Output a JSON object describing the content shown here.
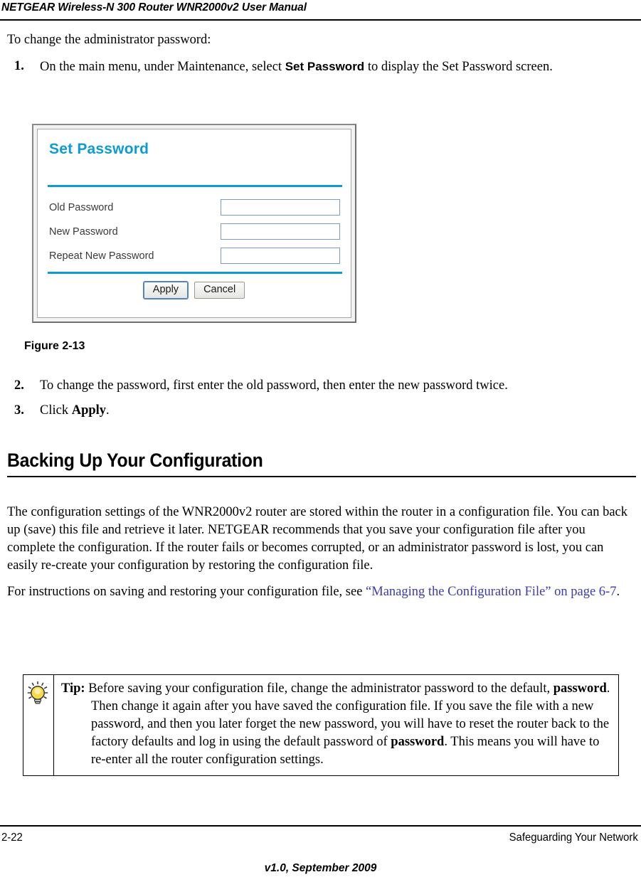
{
  "header": {
    "title": "NETGEAR Wireless-N 300 Router WNR2000v2 User Manual"
  },
  "intro": {
    "lead": "To change the administrator password:"
  },
  "steps": [
    {
      "num": "1.",
      "text_before": "On the main menu, under Maintenance, select ",
      "emphasis": "Set Password",
      "text_after": " to display the Set Password screen."
    },
    {
      "num": "2.",
      "text": "To change the password, first enter the old password, then enter the new password twice."
    },
    {
      "num": "3.",
      "text_before": "Click ",
      "emphasis": "Apply",
      "text_after": "."
    }
  ],
  "figure": {
    "caption": "Figure 2-13",
    "dialog": {
      "title": "Set Password",
      "fields": [
        {
          "label": "Old Password",
          "value": "",
          "placeholder": ""
        },
        {
          "label": "New Password",
          "value": "",
          "placeholder": ""
        },
        {
          "label": "Repeat New Password",
          "value": "",
          "placeholder": ""
        }
      ],
      "buttons": {
        "apply": "Apply",
        "cancel": "Cancel"
      },
      "colors": {
        "accent": "#0e9bd4",
        "field_border": "#7b9bc0",
        "frame": "#8a8a8a"
      }
    }
  },
  "section": {
    "heading": "Backing Up Your Configuration",
    "paragraph": "The configuration settings of the WNR2000v2 router are stored within the router in a configuration file. You can back up (save) this file and retrieve it later. NETGEAR recommends that you save your configuration file after you complete the configuration. If the router fails or becomes corrupted, or an administrator password is lost, you can easily re-create your configuration by restoring the configuration file.",
    "xref_intro": "For instructions on saving and restoring your configuration file, see ",
    "xref_link": "“Managing the Configuration File” on page 6-7",
    "xref_end": ".",
    "xref_color": "#3b3bb3"
  },
  "tip": {
    "icon": "lightbulb-icon",
    "label": "Tip:",
    "part1": " Before saving your configuration file, change the administrator password to the default, ",
    "bold1": "password",
    "part2": ". Then change it again after you have saved the configuration file. If you save the file with a new password, and then you later forget the new password, you will have to reset the router back to the factory defaults and log in using the default password of ",
    "bold2": "password",
    "part3": ". This means you will have to re-enter all the router configuration settings."
  },
  "footer": {
    "page_number": "2-22",
    "chapter": "Safeguarding Your Network",
    "version": "v1.0, September 2009"
  }
}
